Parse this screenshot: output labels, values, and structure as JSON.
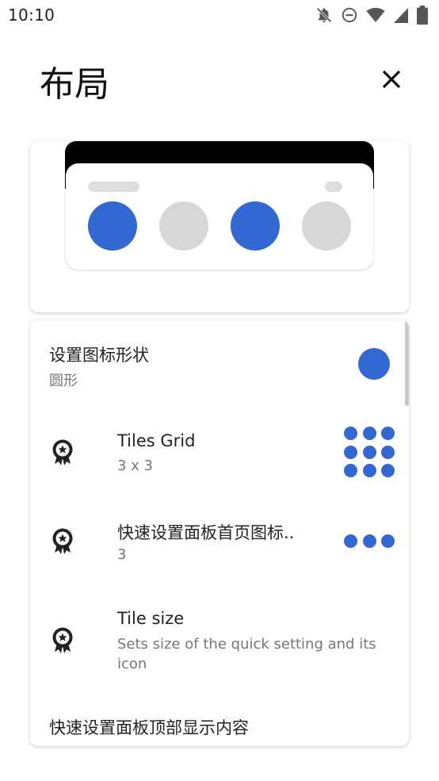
{
  "status_bar": {
    "time": "10:10",
    "icons": [
      "notifications-off-icon",
      "do-not-disturb-icon",
      "wifi-icon",
      "cell-signal-icon",
      "battery-icon"
    ]
  },
  "page": {
    "title": "布局",
    "close_icon": "close-icon"
  },
  "preview": {
    "tiles": [
      {
        "state": "on"
      },
      {
        "state": "off"
      },
      {
        "state": "on"
      },
      {
        "state": "off"
      }
    ]
  },
  "settings": {
    "icon_shape": {
      "title": "设置图标形状",
      "value": "圆形",
      "preview": "circle"
    },
    "tiles_grid": {
      "icon": "award-badge-icon",
      "title": "Tiles Grid",
      "value": "3 x 3",
      "grid_rows": 3,
      "grid_cols": 3
    },
    "qs_home_icons": {
      "icon": "award-badge-icon",
      "title": "快速设置面板首页图标..",
      "value": "3",
      "count": 3
    },
    "tile_size": {
      "icon": "award-badge-icon",
      "title": "Tile size",
      "description": "Sets size of the quick setting and its icon"
    },
    "qs_top_content": {
      "title": "快速设置面板顶部显示内容"
    }
  },
  "colors": {
    "accent": "#3367d1",
    "tile_off": "#d7d7d7",
    "text_primary": "#222222",
    "text_secondary": "#777777"
  }
}
